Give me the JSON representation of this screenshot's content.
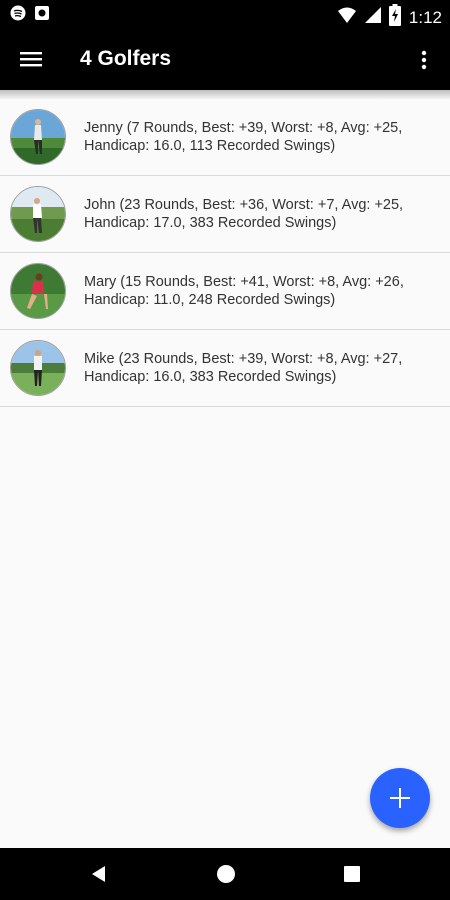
{
  "status_bar": {
    "time": "1:12",
    "icons": [
      "spotify-icon",
      "image-icon",
      "wifi-icon",
      "signal-icon",
      "battery-icon"
    ]
  },
  "app_bar": {
    "title": "4 Golfers",
    "menu_icon": "hamburger-menu-icon",
    "overflow_icon": "more-vert-icon"
  },
  "golfers": [
    {
      "line1": "Jenny (7 Rounds, Best: +39, Worst: +8, Avg: +25,",
      "line2": "Handicap: 16.0, 113 Recorded Swings)"
    },
    {
      "line1": "John (23 Rounds, Best: +36, Worst: +7, Avg: +25,",
      "line2": "Handicap: 17.0, 383 Recorded Swings)"
    },
    {
      "line1": "Mary (15 Rounds, Best: +41, Worst: +8, Avg: +26,",
      "line2": "Handicap: 11.0, 248 Recorded Swings)"
    },
    {
      "line1": "Mike (23 Rounds, Best: +39, Worst: +8, Avg: +27,",
      "line2": "Handicap: 16.0, 383 Recorded Swings)"
    }
  ],
  "fab": {
    "icon": "add-icon",
    "color": "#2962ff"
  },
  "nav_bar": {
    "icons": [
      "back-icon",
      "home-icon",
      "recents-icon"
    ]
  },
  "colors": {
    "app_bar": "#000000",
    "background": "#fafafa",
    "divider": "#d9d9d9",
    "text": "#333333"
  }
}
